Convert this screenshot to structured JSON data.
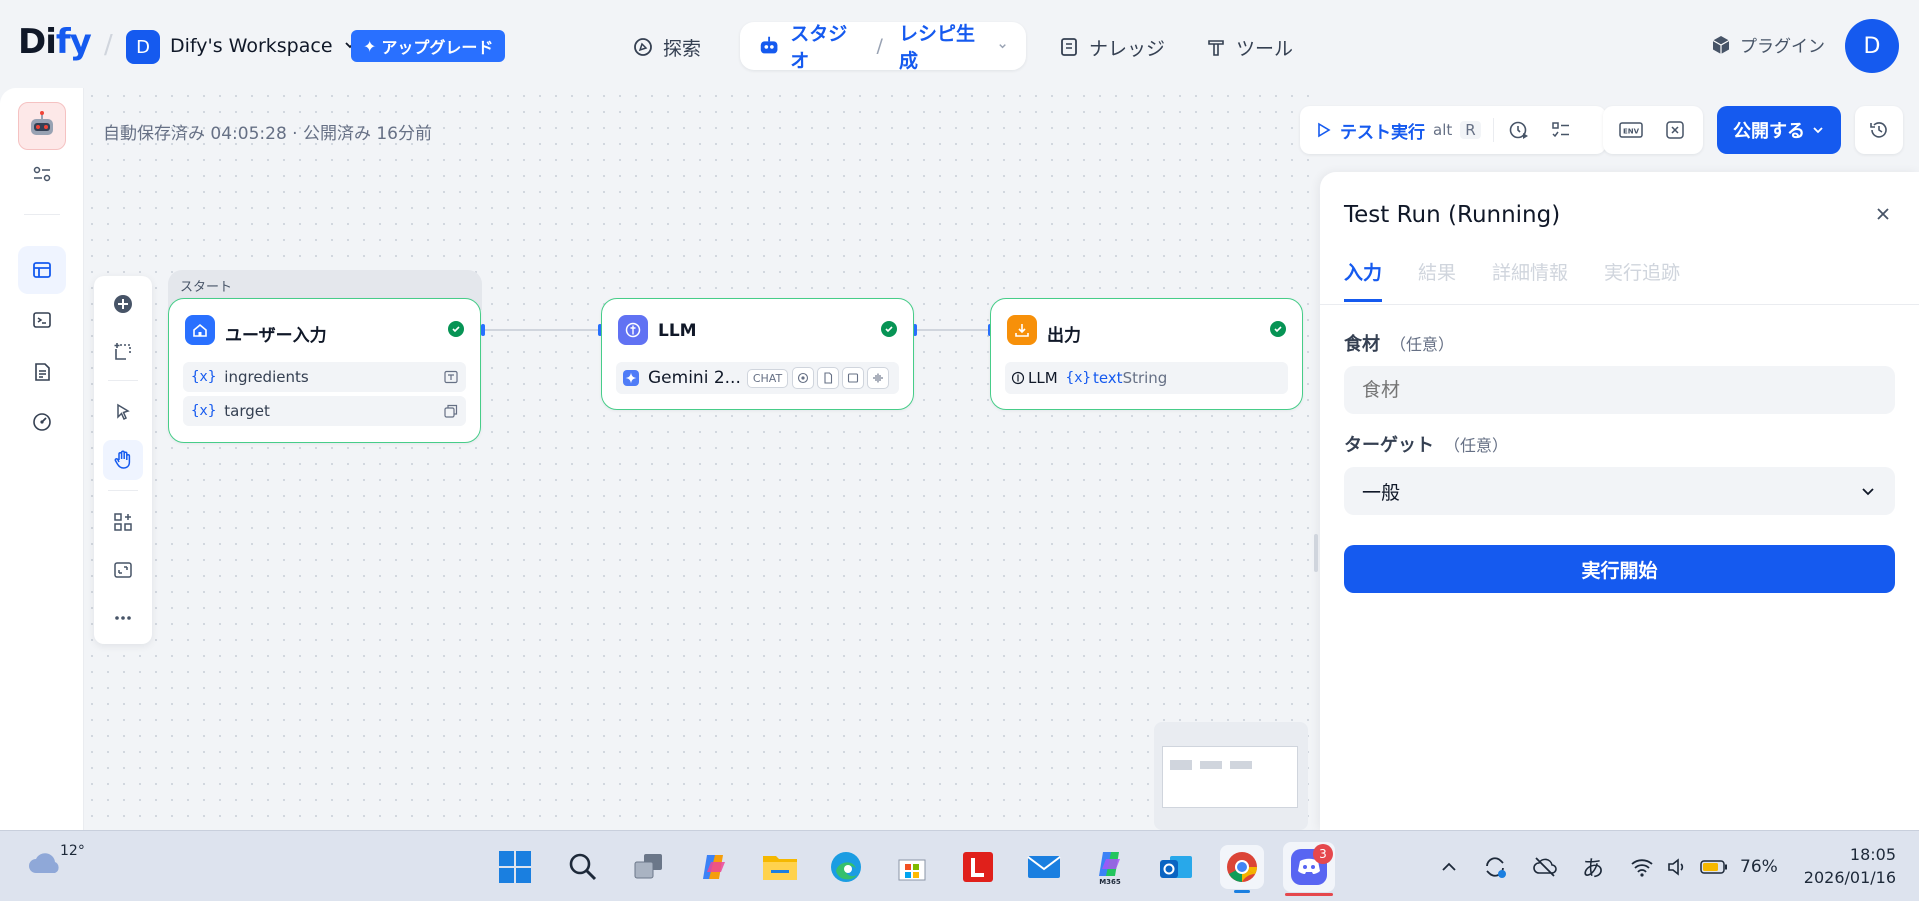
{
  "header": {
    "logo_main": "Di",
    "logo_accent": "fy",
    "workspace_initial": "D",
    "workspace_name": "Dify's Workspace",
    "upgrade_label": "アップグレード",
    "nav": {
      "explore": "探索",
      "studio": "スタジオ",
      "app_name": "レシピ生成",
      "knowledge": "ナレッジ",
      "tools": "ツール"
    },
    "plugin_label": "プラグイン",
    "user_initial": "D"
  },
  "canvas": {
    "save_status": "自動保存済み 04:05:28 · 公開済み 16分前",
    "start_group_label": "スタート",
    "nodes": {
      "start": {
        "title": "ユーザー入力",
        "vars": [
          "ingredients",
          "target"
        ]
      },
      "llm": {
        "title": "LLM",
        "model": "Gemini 2...",
        "mode_tag": "CHAT"
      },
      "output": {
        "title": "出力",
        "source_node": "LLM",
        "var_name": "text",
        "var_type": "String"
      }
    }
  },
  "toolbar": {
    "test_run_label": "テスト実行",
    "shortcut_mod": "alt",
    "shortcut_key": "R",
    "env_label": "ENV",
    "publish_label": "公開する"
  },
  "panel": {
    "title": "Test Run (Running)",
    "tabs": [
      "入力",
      "結果",
      "詳細情報",
      "実行追跡"
    ],
    "fields": [
      {
        "label": "食材",
        "optional": "（任意）",
        "placeholder": "食材"
      },
      {
        "label": "ターゲット",
        "optional": "（任意）",
        "value": "一般"
      }
    ],
    "run_button": "実行開始"
  },
  "taskbar": {
    "weather_temp": "12°",
    "discord_badge": "3",
    "m365_label": "M365",
    "ime_label": "あ",
    "battery": "76%",
    "time": "18:05",
    "date": "2026/01/16"
  },
  "colors": {
    "accent": "#155aef",
    "success": "#079455",
    "node_border": "#47cd89",
    "start_icon": "#2970ff",
    "llm_icon": "#6172f3",
    "output_icon": "#f79009"
  }
}
